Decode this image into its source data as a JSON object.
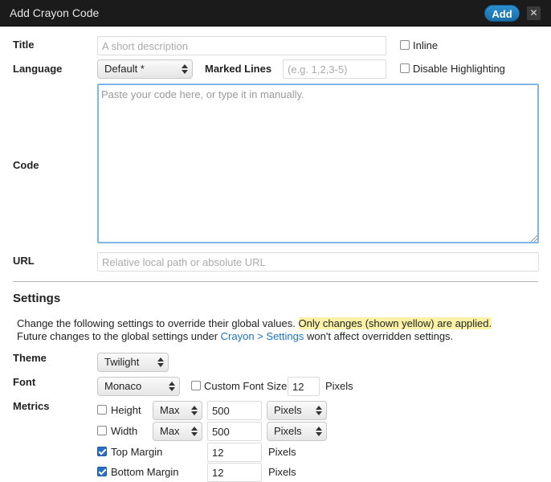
{
  "window": {
    "title": "Add Crayon Code",
    "add_label": "Add",
    "close_label": "✕"
  },
  "fields": {
    "title_label": "Title",
    "title_placeholder": "A short description",
    "inline_label": "Inline",
    "language_label": "Language",
    "language_value": "Default *",
    "marked_lines_label": "Marked Lines",
    "marked_lines_placeholder": "(e.g. 1,2,3-5)",
    "disable_highlighting_label": "Disable Highlighting",
    "code_label": "Code",
    "code_placeholder": "Paste your code here, or type it in manually.",
    "url_label": "URL",
    "url_placeholder": "Relative local path or absolute URL"
  },
  "settings": {
    "heading": "Settings",
    "desc_part1": "Change the following settings to override their global values. ",
    "desc_highlight": "Only changes (shown yellow) are applied.",
    "desc_part2": "Future changes to the global settings under ",
    "desc_link": "Crayon > Settings",
    "desc_part3": " won't affect overridden settings.",
    "theme_label": "Theme",
    "theme_value": "Twilight",
    "font_label": "Font",
    "font_value": "Monaco",
    "custom_font_size_label": "Custom Font Size",
    "custom_font_size_value": "12",
    "pixels_label": "Pixels",
    "metrics_label": "Metrics",
    "height_label": "Height",
    "height_mode": "Max",
    "height_value": "500",
    "height_unit": "Pixels",
    "width_label": "Width",
    "width_mode": "Max",
    "width_value": "500",
    "width_unit": "Pixels",
    "top_margin_label": "Top Margin",
    "top_margin_value": "12",
    "bottom_margin_label": "Bottom Margin",
    "bottom_margin_value": "12",
    "margin_unit": "Pixels"
  },
  "checkboxes": {
    "inline": false,
    "disable_highlighting": false,
    "custom_font_size": false,
    "height": false,
    "width": false,
    "top_margin": true,
    "bottom_margin": true
  },
  "colors": {
    "accent": "#2a6fc9",
    "highlight": "#fbf2a8",
    "titlebar": "#1b1b1b"
  }
}
